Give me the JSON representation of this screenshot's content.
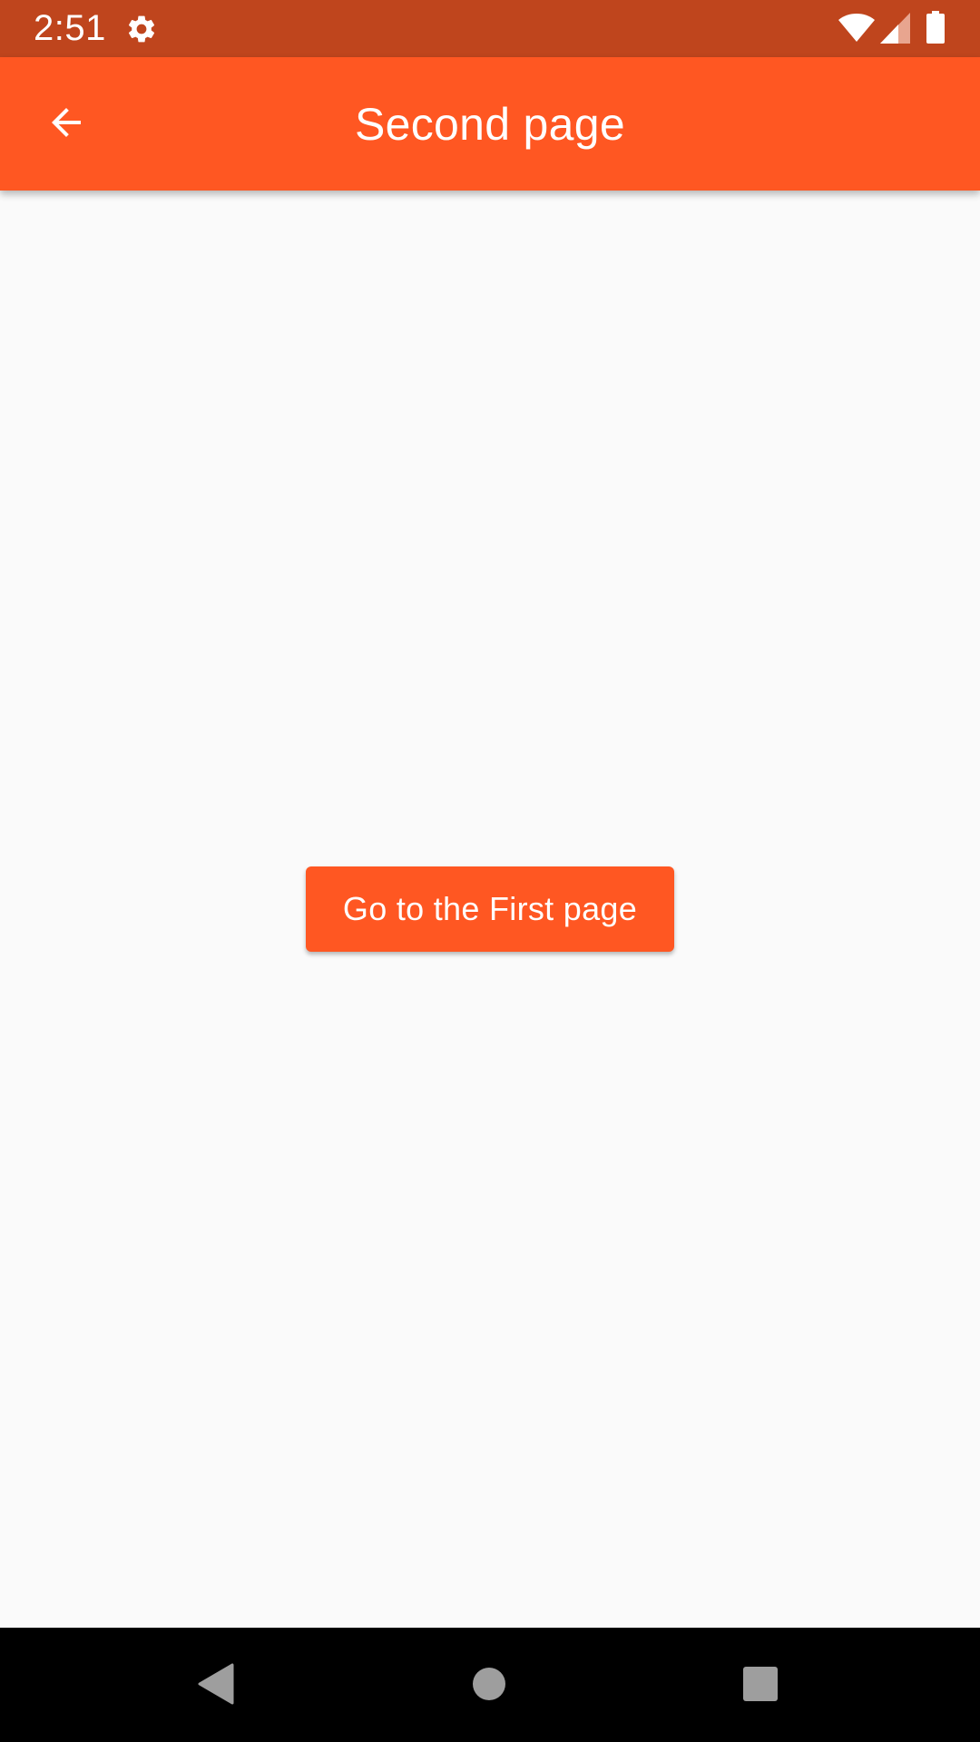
{
  "status_bar": {
    "time": "2:51",
    "icons": [
      "gear-icon",
      "wifi-icon",
      "signal-icon",
      "battery-icon"
    ]
  },
  "app_bar": {
    "title": "Second page",
    "back_icon": "arrow-back-icon"
  },
  "main": {
    "button_label": "Go to the First page"
  },
  "nav_bar": {
    "buttons": [
      "back-triangle-icon",
      "home-circle-icon",
      "recents-square-icon"
    ]
  },
  "colors": {
    "accent": "#ff5722",
    "status_bar": "#bf451d",
    "background": "#fafafa",
    "nav_bar": "#000000",
    "nav_icons": "#9e9e9e"
  }
}
